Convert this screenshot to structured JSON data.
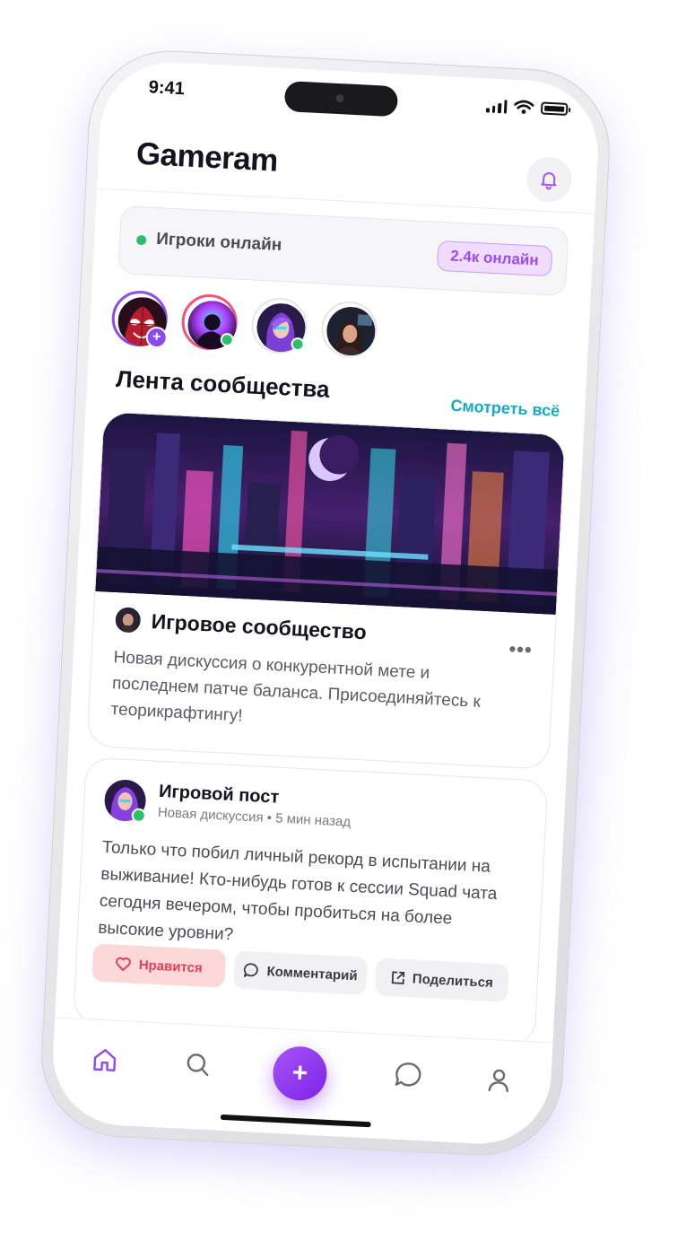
{
  "status_bar": {
    "time": "9:41"
  },
  "header": {
    "app_title": "Gameram"
  },
  "online": {
    "label": "Игроки онлайн",
    "badge": "2.4к онлайн"
  },
  "stories": [
    {
      "name": "my-story",
      "ring": "purple",
      "add": "+"
    },
    {
      "name": "story-2",
      "ring": "red",
      "online": true
    },
    {
      "name": "story-3",
      "ring": "plain",
      "online": true
    },
    {
      "name": "story-4",
      "ring": "plain",
      "online": false
    }
  ],
  "feed": {
    "section_title": "Лента сообщества",
    "see_all": "Смотреть всё",
    "featured_post": {
      "title": "Игровое сообщество",
      "more": "•••",
      "text": "Новая дискуссия о конкурентной мете и последнем патче баланса. Присоединяйтесь к теорикрафтингу!"
    },
    "post": {
      "author": "Игровой пост",
      "meta": "Новая дискуссия • 5 мин назад",
      "text": "Только что побил личный рекорд в испытании на выживание! Кто-нибудь готов к сессии Squad чата сегодня вечером, чтобы пробиться на более высокие уровни?",
      "actions": {
        "like": "Нравится",
        "comment": "Комментарий",
        "share": "Поделиться"
      }
    }
  },
  "fab_label": "+",
  "tabbar": [
    "home-icon",
    "search-icon",
    "add-button",
    "chat-icon",
    "profile-icon"
  ],
  "colors": {
    "accent": "#8a4cf0",
    "online_green": "#2bc06b",
    "link": "#14a9c9",
    "like_bg": "#fcd8d8",
    "like_text": "#e0405a"
  }
}
